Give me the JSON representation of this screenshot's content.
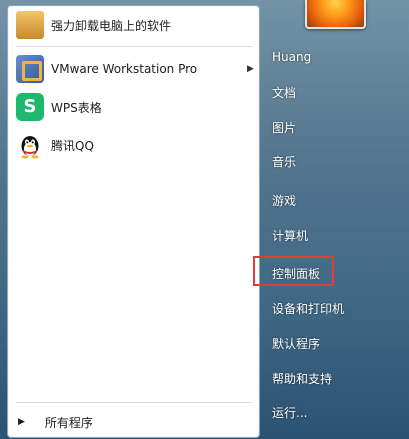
{
  "left_panel": {
    "items": [
      {
        "label": "强力卸载电脑上的软件",
        "icon": "uninstall-icon"
      },
      {
        "label": "VMware Workstation Pro",
        "icon": "vmware-icon"
      },
      {
        "label": "WPS表格",
        "icon": "wps-spreadsheet-icon"
      },
      {
        "label": "腾讯QQ",
        "icon": "qq-icon"
      }
    ],
    "all_programs": "所有程序"
  },
  "right_panel": {
    "items": [
      {
        "label": "Huang"
      },
      {
        "label": "文档"
      },
      {
        "label": "图片"
      },
      {
        "label": "音乐"
      },
      {
        "label": "游戏"
      },
      {
        "label": "计算机"
      },
      {
        "label": "控制面板"
      },
      {
        "label": "设备和打印机"
      },
      {
        "label": "默认程序"
      },
      {
        "label": "帮助和支持"
      },
      {
        "label": "运行..."
      }
    ]
  },
  "highlight_color": "#e23b3b"
}
